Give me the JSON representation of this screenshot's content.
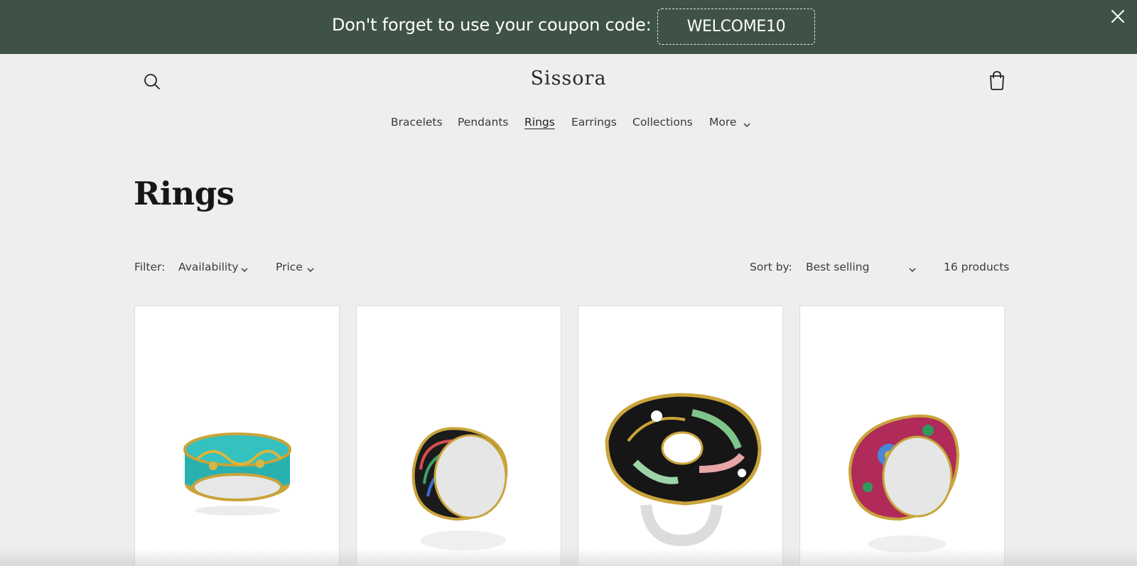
{
  "banner": {
    "message": "Don't forget to use your coupon code:",
    "coupon_code": "WELCOME10",
    "close_icon": "close-icon",
    "background": "#3f5247"
  },
  "header": {
    "logo": "Sissora",
    "search_icon": "search-icon",
    "cart_icon": "cart-icon"
  },
  "nav": {
    "items": [
      {
        "label": "Bracelets"
      },
      {
        "label": "Pendants"
      },
      {
        "label": "Rings",
        "active": true
      },
      {
        "label": "Earrings"
      },
      {
        "label": "Collections"
      },
      {
        "label": "More"
      }
    ]
  },
  "collection": {
    "title": "Rings",
    "filter_label": "Filter:",
    "filters": [
      "Availability",
      "Price"
    ],
    "sort_label": "Sort by:",
    "sort_value": "Best selling",
    "product_count": "16 products"
  },
  "products": [
    {
      "image": "turquoise-gold-swirl-ring"
    },
    {
      "image": "black-gold-multicolor-band-ring"
    },
    {
      "image": "wavy-disc-enamel-ring"
    },
    {
      "image": "pink-floral-enamel-ring"
    }
  ]
}
